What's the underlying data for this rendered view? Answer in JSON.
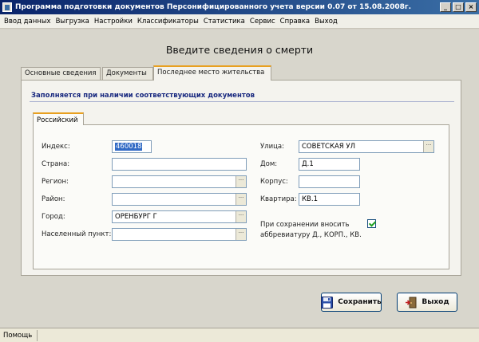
{
  "window": {
    "title": "Программа подготовки документов Персонифицированного учета версии 0.07 от 15.08.2008г."
  },
  "menu": [
    "Ввод данных",
    "Выгрузка",
    "Настройки",
    "Классификаторы",
    "Статистика",
    "Сервис",
    "Справка",
    "Выход"
  ],
  "form": {
    "title": "Введите сведения о смерти"
  },
  "tabs": [
    "Основные сведения",
    "Документы",
    "Последнее место жительства"
  ],
  "panel": {
    "heading": "Заполняется при наличии соответствующих документов",
    "subtab": "Российский"
  },
  "fields": {
    "index": {
      "label": "Индекс:",
      "value": "460018"
    },
    "country": {
      "label": "Страна:",
      "value": ""
    },
    "region": {
      "label": "Регион:",
      "value": ""
    },
    "district": {
      "label": "Район:",
      "value": ""
    },
    "city": {
      "label": "Город:",
      "value": "ОРЕНБУРГ Г"
    },
    "settlement": {
      "label": "Населенный пункт:",
      "value": ""
    },
    "street": {
      "label": "Улица:",
      "value": "СОВЕТСКАЯ УЛ"
    },
    "house": {
      "label": "Дом:",
      "value": "Д.1"
    },
    "building": {
      "label": "Корпус:",
      "value": ""
    },
    "apartment": {
      "label": "Квартира:",
      "value": "КВ.1"
    }
  },
  "checkbox": {
    "label_line1": "При сохранении вносить",
    "label_line2": "аббревиатуру Д., КОРП., КВ.",
    "checked": true
  },
  "buttons": {
    "save": "Сохранить",
    "exit": "Выход"
  },
  "status": {
    "help": "Помощь"
  },
  "icons": {
    "save": "floppy-disk-icon",
    "exit": "exit-door-icon"
  }
}
